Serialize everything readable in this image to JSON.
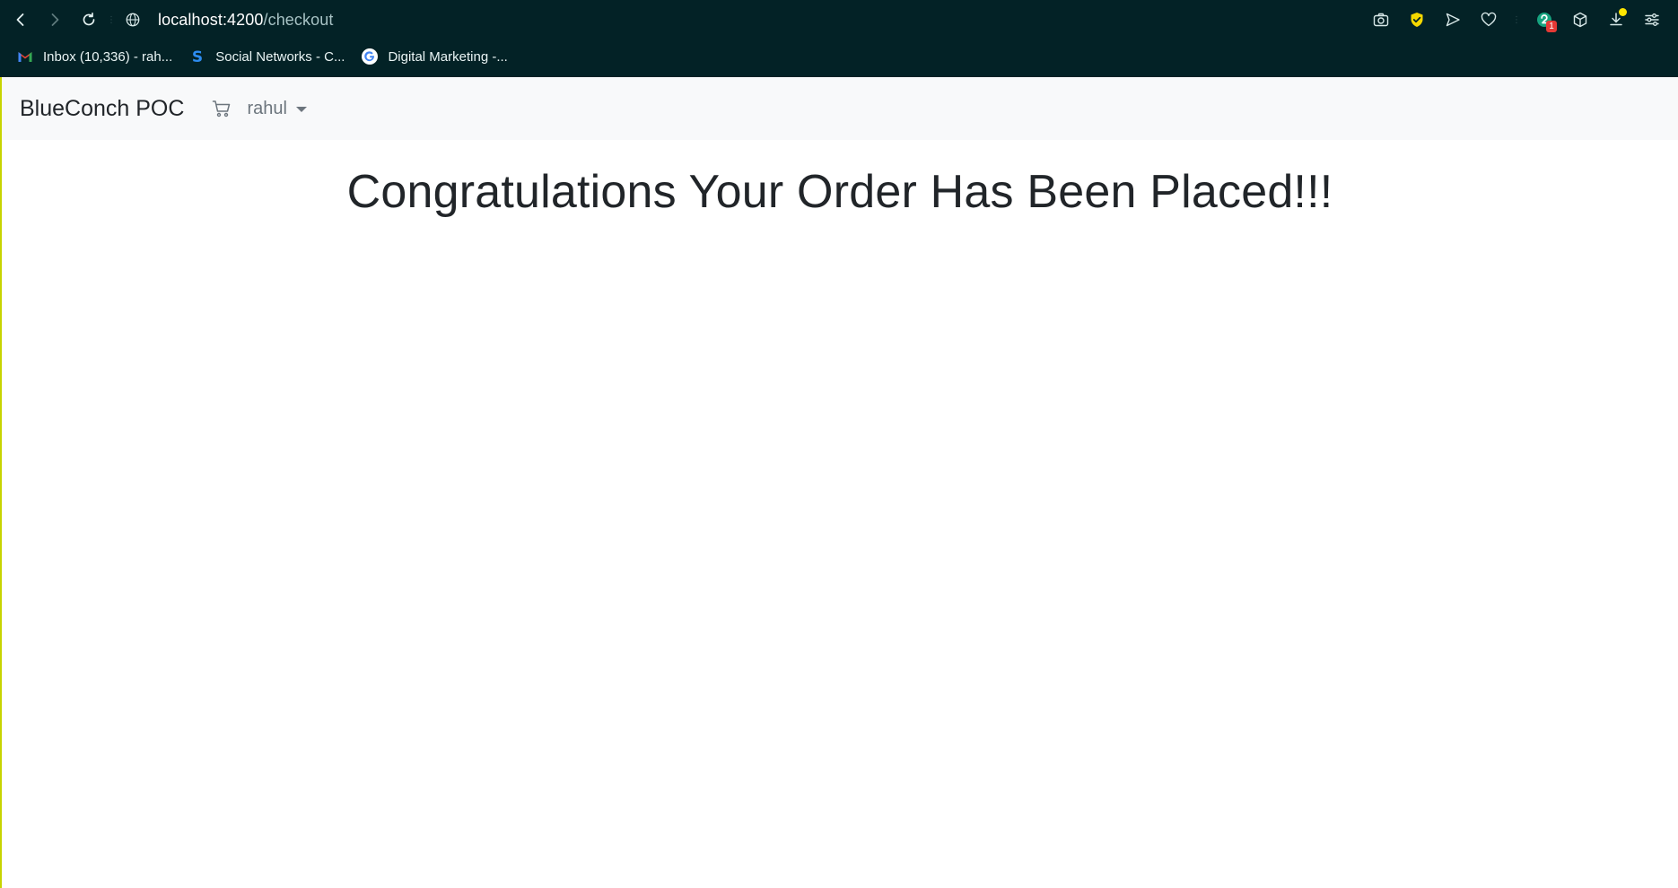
{
  "browser": {
    "url_host": "localhost:4200",
    "url_path": "/checkout",
    "extension_badge_count": "1",
    "bookmarks": [
      {
        "label": "Inbox (10,336) - rah...",
        "icon": "gmail-icon"
      },
      {
        "label": "Social Networks - C...",
        "icon": "s-brand-icon"
      },
      {
        "label": "Digital Marketing -...",
        "icon": "google-icon"
      }
    ]
  },
  "app": {
    "brand": "BlueConch POC",
    "user_menu_label": "rahul",
    "headline": "Congratulations Your Order Has Been Placed!!!"
  },
  "colors": {
    "browser_chrome": "#032226",
    "navbar": "#f8f9fa",
    "text": "#212529",
    "muted": "#6c757d"
  }
}
